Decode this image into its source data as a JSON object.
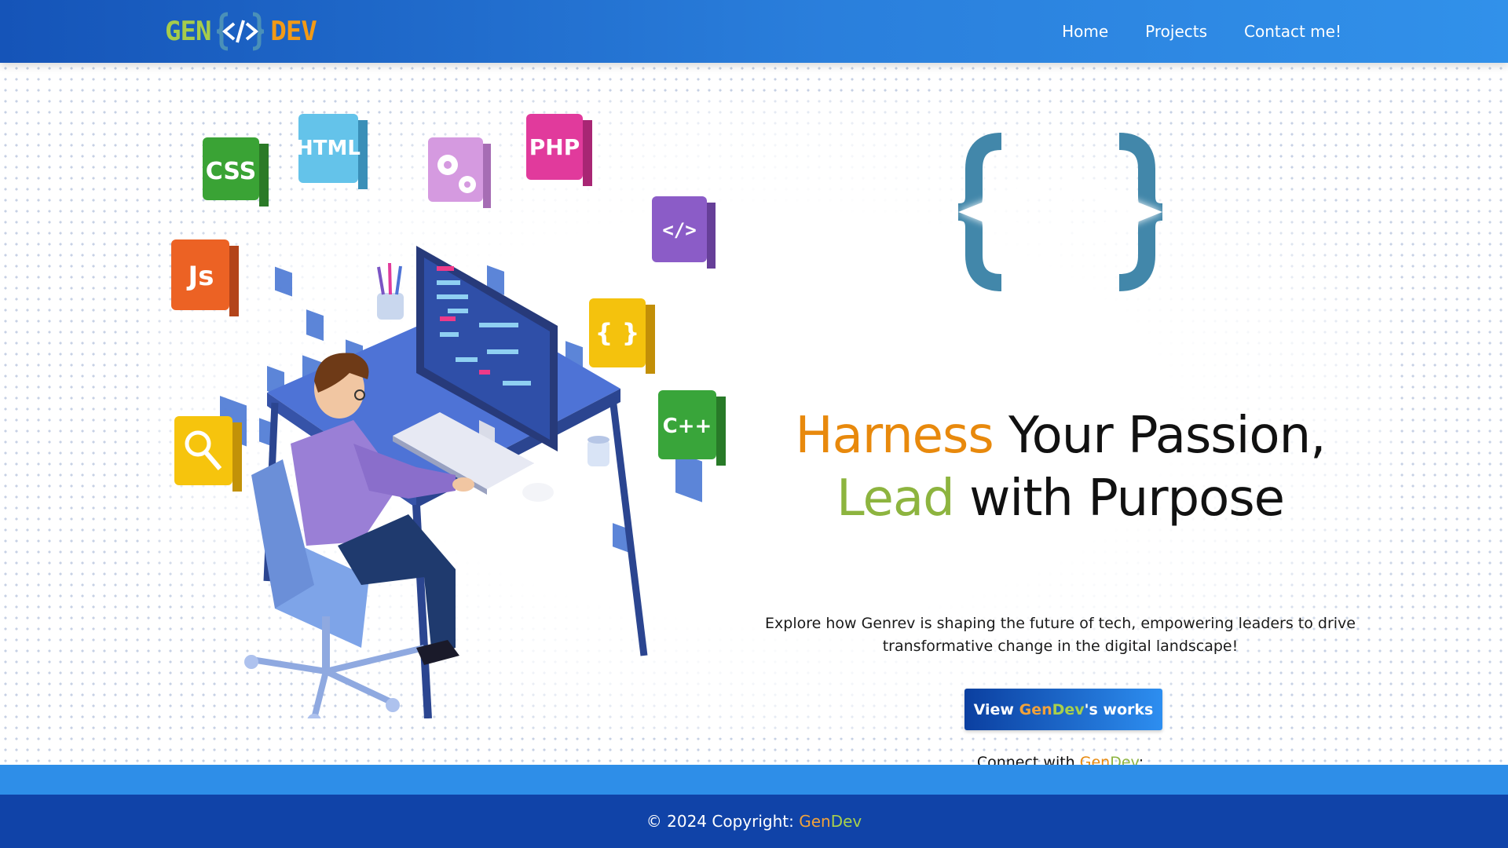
{
  "brand": {
    "left": "GEN",
    "right": "DEV"
  },
  "nav": {
    "items": [
      {
        "label": "Home"
      },
      {
        "label": "Projects"
      },
      {
        "label": "Contact me!"
      }
    ]
  },
  "illustration": {
    "icons": [
      "CSS",
      "HTML",
      "PHP",
      "Js",
      "</>",
      "{ }",
      "C++"
    ]
  },
  "hero": {
    "headline_part1_accent": "Harness",
    "headline_part1_rest": " Your Passion,",
    "headline_part2_accent": "Lead",
    "headline_part2_rest": " with Purpose",
    "subtext": "Explore how Genrev is shaping the future of tech, empowering leaders to drive transformative change in the digital landscape!",
    "cta_prefix": "View ",
    "cta_gen": "Gen",
    "cta_dev": "Dev",
    "cta_suffix": "'s works",
    "connect_prefix": "Connect with ",
    "connect_gen": "Gen",
    "connect_dev": "Dev",
    "connect_suffix": ":"
  },
  "socials": [
    {
      "name": "facebook-icon",
      "color": "#1877f2"
    },
    {
      "name": "gmail-icon",
      "color": "#ea4335"
    },
    {
      "name": "github-icon",
      "color": "#111111"
    }
  ],
  "footer": {
    "prefix": "© 2024 Copyright: ",
    "gen": "Gen",
    "dev": "Dev"
  },
  "colors": {
    "nav_start": "#1554b8",
    "nav_end": "#3191ea",
    "accent_orange": "#e8890c",
    "accent_green": "#8db43f",
    "footer_band": "#2e8ee8",
    "footer": "#1043a8"
  }
}
